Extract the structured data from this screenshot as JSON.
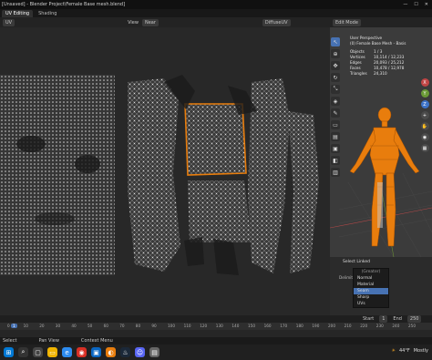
{
  "window": {
    "title": "[Unsaved] - Blender Project\\Female Base mesh.blend]",
    "controls": [
      "—",
      "☐",
      "✕"
    ]
  },
  "workspace_tabs": [
    {
      "label": "UV Editing",
      "active": true
    },
    {
      "label": "Shading",
      "active": false
    }
  ],
  "uv_editor": {
    "mode": "UV",
    "view_label": "View",
    "near_label": "Near",
    "image_name": "DiffuseUV"
  },
  "viewport": {
    "mode": "Edit Mode",
    "view_name": "User Perspective",
    "object_name": "(0) Female Base Mesh - Basis",
    "stats": [
      {
        "key": "Objects",
        "value": "1 / 3"
      },
      {
        "key": "Vertices",
        "value": "10,114 / 12,233"
      },
      {
        "key": "Edges",
        "value": "20,093 / 25,212"
      },
      {
        "key": "Faces",
        "value": "10,478 / 12,978"
      },
      {
        "key": "Triangles",
        "value": "24,310"
      }
    ],
    "accent_color": "#e87d0d"
  },
  "properties": {
    "select_linked": "Select Linked",
    "delimit_label": "Delimit",
    "menu_header": "(Greater)",
    "menu_items": [
      {
        "label": "Normal",
        "selected": false
      },
      {
        "label": "Material",
        "selected": false
      },
      {
        "label": "Seam",
        "selected": true
      },
      {
        "label": "Sharp",
        "selected": false
      },
      {
        "label": "UVs",
        "selected": false
      }
    ]
  },
  "timeline": {
    "ticks": [
      "0",
      "10",
      "20",
      "30",
      "40",
      "50",
      "60",
      "70",
      "80",
      "90",
      "100",
      "110",
      "120",
      "130",
      "140",
      "150",
      "160",
      "170",
      "180",
      "190",
      "200",
      "210",
      "220",
      "230",
      "240",
      "250"
    ],
    "current_frame": "1",
    "start_label": "Start",
    "start_value": "1",
    "end_label": "End",
    "end_value": "250"
  },
  "statusbar": {
    "left": "Select",
    "mid": "Pan View",
    "right": "Context Menu"
  },
  "taskbar": {
    "weather": "44°F",
    "weather_desc": "Mostly"
  }
}
